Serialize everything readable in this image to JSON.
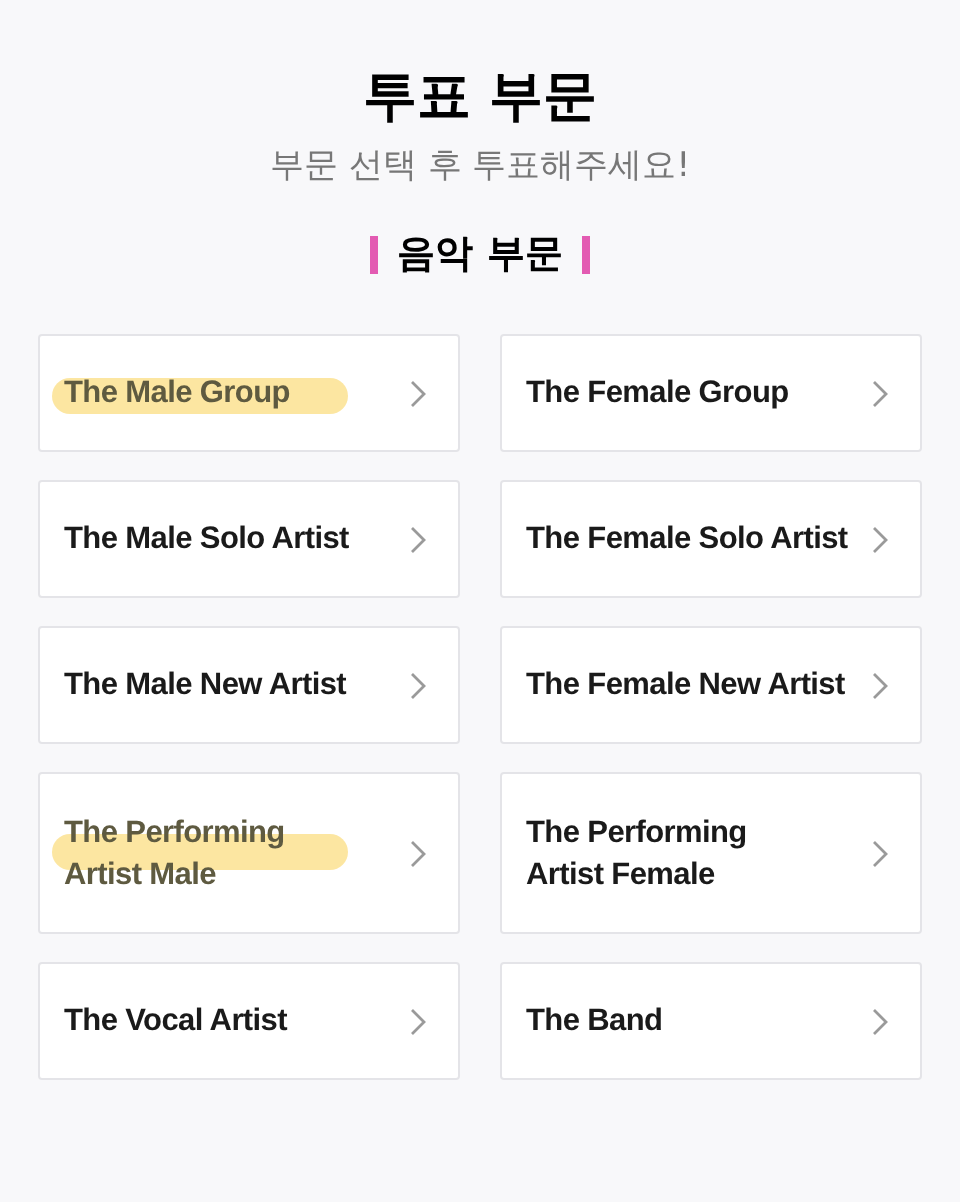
{
  "title": "투표 부문",
  "subtitle": "부문 선택 후 투표해주세요!",
  "section": {
    "title": "음악 부문"
  },
  "categories": [
    {
      "lines": [
        "The Male Group"
      ],
      "highlighted": true
    },
    {
      "lines": [
        "The Female Group"
      ],
      "highlighted": false
    },
    {
      "lines": [
        "The Male Solo Artist"
      ],
      "highlighted": false
    },
    {
      "lines": [
        "The Female Solo Artist"
      ],
      "highlighted": false
    },
    {
      "lines": [
        "The Male New Artist"
      ],
      "highlighted": false
    },
    {
      "lines": [
        "The Female New Artist"
      ],
      "highlighted": false
    },
    {
      "lines": [
        "The Performing",
        "Artist Male"
      ],
      "highlighted": true
    },
    {
      "lines": [
        "The Performing",
        "Artist Female"
      ],
      "highlighted": false
    },
    {
      "lines": [
        "The Vocal Artist"
      ],
      "highlighted": false
    },
    {
      "lines": [
        "The Band"
      ],
      "highlighted": false
    }
  ]
}
